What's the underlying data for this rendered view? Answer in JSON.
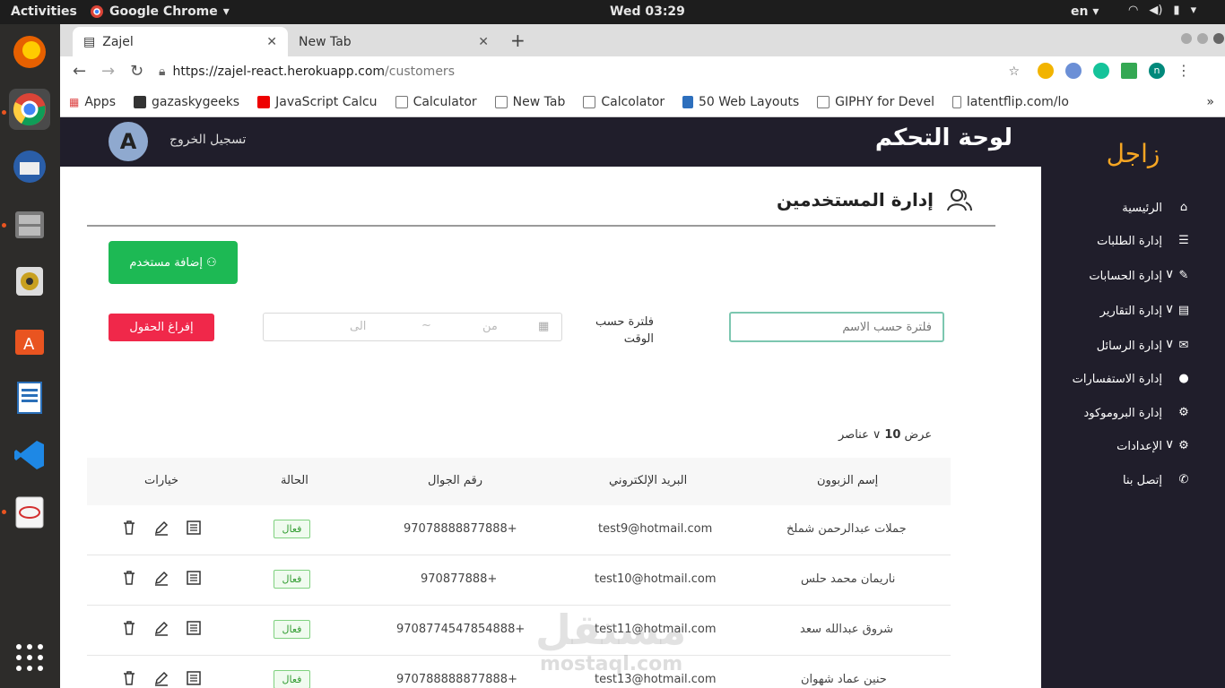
{
  "ubuntu_topbar": {
    "activities": "Activities",
    "app_name": "Google Chrome",
    "clock": "Wed 03:29",
    "lang": "en"
  },
  "browser": {
    "tabs": [
      {
        "label": "Zajel"
      },
      {
        "label": "New Tab"
      }
    ],
    "url_host": "https://zajel-react.herokuapp.com",
    "url_path": "/customers",
    "bookmarks": [
      "Apps",
      "gazaskygeeks",
      "JavaScript Calcu",
      "Calculator",
      "New Tab",
      "Calcolator",
      "50 Web Layouts",
      "GIPHY for Devel",
      "latentflip.com/lo"
    ],
    "profile_initial": "n"
  },
  "app": {
    "brand": "زاجل",
    "header_title": "لوحة التحكم",
    "logout": "تسجيل الخروج",
    "avatar_initial": "A",
    "colors": {
      "accent": "#f6a623",
      "dark": "#201e2b",
      "green": "#1db954",
      "red": "#f0284a"
    },
    "sidebar": [
      {
        "label": "الرئيسية",
        "icon": "home-icon",
        "chevron": false
      },
      {
        "label": "إدارة الطلبات",
        "icon": "list-icon",
        "chevron": false
      },
      {
        "label": "إدارة الحسابات",
        "icon": "wrench-icon",
        "chevron": true
      },
      {
        "label": "إدارة التقارير",
        "icon": "report-icon",
        "chevron": true
      },
      {
        "label": "إدارة الرسائل",
        "icon": "mail-icon",
        "chevron": true
      },
      {
        "label": "إدارة الاستفسارات",
        "icon": "chat-icon",
        "chevron": false
      },
      {
        "label": "إدارة البروموكود",
        "icon": "gear-icon",
        "chevron": false
      },
      {
        "label": "الإعدادات",
        "icon": "settings-icon",
        "chevron": true
      },
      {
        "label": "إتصل بنا",
        "icon": "phone-icon",
        "chevron": false
      }
    ],
    "section_title": "إدارة المستخدمين",
    "add_user": "إضافة مستخدم",
    "clear_fields": "إفراغ الحقول",
    "date_to": "الى",
    "date_sep": "~",
    "date_from": "من",
    "time_filter_label": "فلترة حسب الوقت",
    "name_filter_placeholder": "فلترة حسب الاسم",
    "page_size": {
      "prefix": "عرض",
      "value": "10",
      "suffix": "عناصر"
    },
    "table": {
      "headers": [
        "إسم الزبوون",
        "البريد الإلكتروني",
        "رقم الجوال",
        "الحالة",
        "خيارات"
      ],
      "rows": [
        {
          "name": "جملات عبدالرحمن شملخ",
          "email": "test9@hotmail.com",
          "phone": "97078888877888+",
          "status": "فعال"
        },
        {
          "name": "ناريمان محمد حلس",
          "email": "test10@hotmail.com",
          "phone": "970877888+",
          "status": "فعال"
        },
        {
          "name": "شروق عبدالله سعد",
          "email": "test11@hotmail.com",
          "phone": "9708774547854888+",
          "status": "فعال"
        },
        {
          "name": "حنين عماد شهوان",
          "email": "test13@hotmail.com",
          "phone": "970788888877888+",
          "status": "فعال"
        }
      ]
    },
    "watermark": "مستقل",
    "watermark_url": "mostaql.com"
  }
}
